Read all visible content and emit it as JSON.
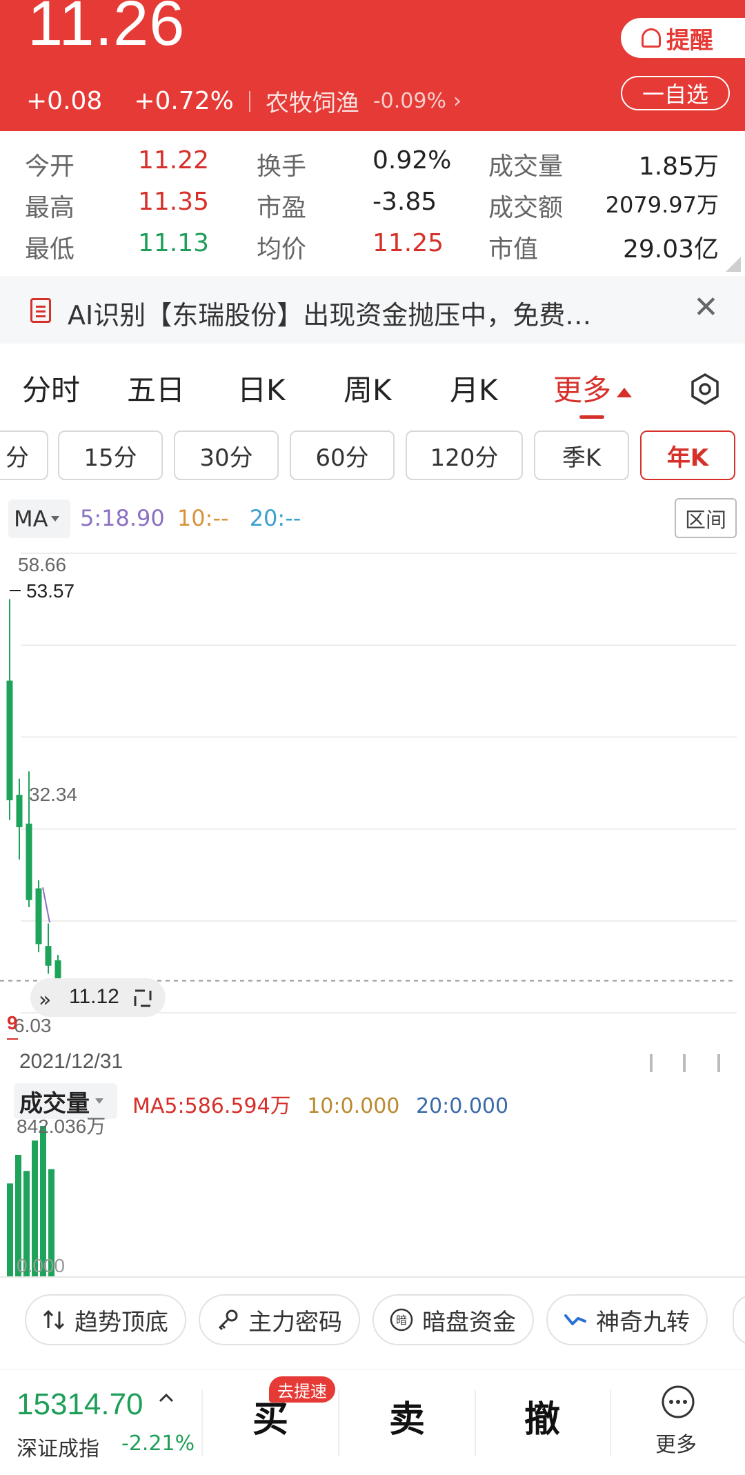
{
  "header": {
    "price": "11.26",
    "change": "+0.08",
    "change_pct": "+0.72%",
    "sector": "农牧饲渔",
    "sector_change": "-0.09%",
    "alert_label": "提醒",
    "watch_label": "一自选"
  },
  "stats": [
    {
      "label": "今开",
      "value": "11.22"
    },
    {
      "label": "换手",
      "value": "0.92%"
    },
    {
      "label": "成交量",
      "value": "1.85万"
    },
    {
      "label": "最高",
      "value": "11.35"
    },
    {
      "label": "市盈",
      "value": "-3.85"
    },
    {
      "label": "成交额",
      "value": "2079.97万"
    },
    {
      "label": "最低",
      "value": "11.13"
    },
    {
      "label": "均价",
      "value": "11.25"
    },
    {
      "label": "市值",
      "value": "29.03亿"
    }
  ],
  "banner": {
    "text": "AI识别【东瑞股份】出现资金抛压中，免费…",
    "close": "✕"
  },
  "tabs": [
    "分时",
    "五日",
    "日K",
    "周K",
    "月K",
    "更多"
  ],
  "subtabs": [
    "分",
    "15分",
    "30分",
    "60分",
    "120分",
    "季K",
    "年K"
  ],
  "ma": {
    "select": "MA",
    "ma5": "5:18.90",
    "ma10": "10:--",
    "ma20": "20:--",
    "range": "区间"
  },
  "price_axis": {
    "top": "58.66",
    "high_mark": "53.57",
    "mid": "32.34",
    "low": "6.03",
    "current": "11.12",
    "low_marker": "9"
  },
  "chart_data": {
    "type": "candlestick",
    "ylim": [
      6.03,
      58.66
    ],
    "tick_labels": [
      "58.66",
      "32.34",
      "6.03"
    ],
    "start_date": "2021/12/31",
    "candles": [
      {
        "open": 44.5,
        "close": 31.2,
        "high": 53.57,
        "low": 29.0
      },
      {
        "open": 31.8,
        "close": 28.2,
        "high": 33.6,
        "low": 24.6
      },
      {
        "open": 28.6,
        "close": 20.1,
        "high": 34.4,
        "low": 19.3
      },
      {
        "open": 21.4,
        "close": 15.2,
        "high": 22.3,
        "low": 14.3
      },
      {
        "open": 15.0,
        "close": 12.8,
        "high": 17.5,
        "low": 11.9
      },
      {
        "open": 13.4,
        "close": 11.2,
        "high": 14.0,
        "low": 11.1
      }
    ],
    "ma5_label": "5:18.90",
    "current_price": 11.12,
    "color_down": "#1ea35a"
  },
  "volume": {
    "select": "成交量",
    "ma5": "MA5:586.594万",
    "ma10": "10:0.000",
    "ma20": "20:0.000",
    "top_label": "842.036万",
    "bottom_label": "0.000",
    "values": [
      520,
      680,
      590,
      760,
      842,
      600
    ]
  },
  "tools": [
    {
      "label": "趋势顶底",
      "icon": "sort-arrows-icon"
    },
    {
      "label": "主力密码",
      "icon": "key-icon"
    },
    {
      "label": "暗盘资金",
      "icon": "dark-pool-icon"
    },
    {
      "label": "神奇九转",
      "icon": "zigzag-icon"
    }
  ],
  "bottom": {
    "index_value": "15314.70",
    "index_name": "深证成指",
    "index_change": "-2.21%",
    "buy": "买",
    "buy_badge": "去提速",
    "sell": "卖",
    "cancel": "撤",
    "more": "更多"
  },
  "colors": {
    "header_bg": "#e53a35",
    "up": "#d6302a",
    "down": "#1e9e58"
  }
}
